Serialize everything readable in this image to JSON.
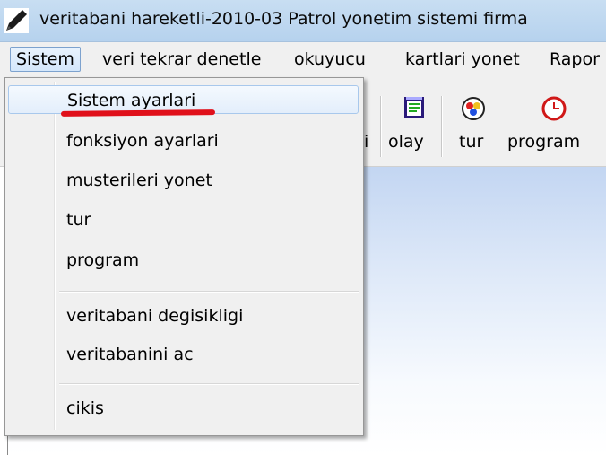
{
  "window": {
    "title": "veritabani hareketli-2010-03  Patrol yonetim sistemi    firma"
  },
  "menubar": {
    "items": [
      "Sistem",
      "veri tekrar denetle",
      "okuyucu",
      "kartlari yonet",
      "Rapor"
    ]
  },
  "toolbar": {
    "items": [
      {
        "label": "i",
        "icon": "partial-icon"
      },
      {
        "label": "olay",
        "icon": "notepad-icon"
      },
      {
        "label": "tur",
        "icon": "tour-icon"
      },
      {
        "label": "program",
        "icon": "clock-icon"
      }
    ]
  },
  "dropdown": {
    "items": [
      {
        "label": "Sistem ayarlari",
        "highlighted": true
      },
      {
        "label": "fonksiyon ayarlari"
      },
      {
        "label": "musterileri yonet"
      },
      {
        "label": "tur"
      },
      {
        "label": "program"
      },
      {
        "label": "veritabani degisikligi"
      },
      {
        "label": "veritabanini ac"
      },
      {
        "label": "cikis"
      }
    ]
  },
  "colors": {
    "annotation": "#e0101a",
    "accent": "#7da2ce"
  }
}
